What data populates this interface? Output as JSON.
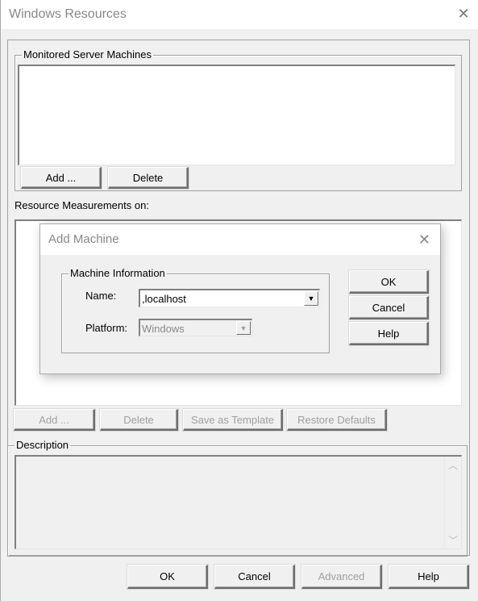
{
  "window": {
    "title": "Windows Resources",
    "close_icon": "close-icon"
  },
  "monitored": {
    "group_label": "Monitored Server Machines",
    "items": [],
    "add_label": "Add ...",
    "delete_label": "Delete"
  },
  "measurements": {
    "label": "Resource Measurements on:",
    "add_label": "Add ...",
    "delete_label": "Delete",
    "save_template_label": "Save as Template",
    "restore_defaults_label": "Restore Defaults"
  },
  "description": {
    "group_label": "Description",
    "text": "",
    "scroll_up_icon": "^",
    "scroll_down_icon": "v"
  },
  "footer": {
    "ok_label": "OK",
    "cancel_label": "Cancel",
    "advanced_label": "Advanced",
    "help_label": "Help"
  },
  "add_machine_dialog": {
    "title": "Add Machine",
    "group_label": "Machine Information",
    "name_label": "Name:",
    "name_value": ",localhost",
    "platform_label": "Platform:",
    "platform_value": "Windows",
    "ok_label": "OK",
    "cancel_label": "Cancel",
    "help_label": "Help"
  }
}
